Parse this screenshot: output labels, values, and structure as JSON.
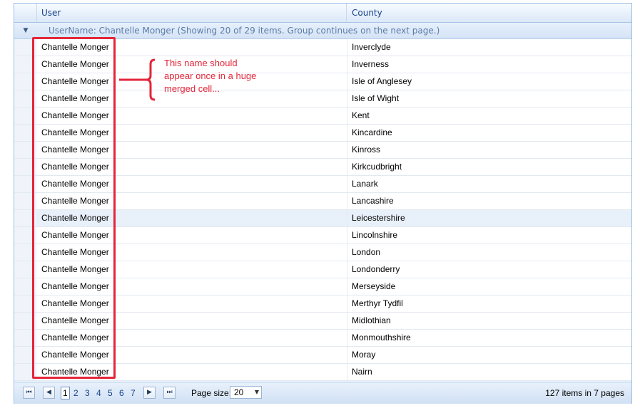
{
  "header": {
    "user": "User",
    "county": "County"
  },
  "group": {
    "expander_icon": "collapse-triangle-icon",
    "text": "UserName: Chantelle Monger (Showing 20 of 29 items. Group continues on the next page.)"
  },
  "rows": [
    {
      "user": "Chantelle Monger",
      "county": "Inverclyde"
    },
    {
      "user": "Chantelle Monger",
      "county": "Inverness"
    },
    {
      "user": "Chantelle Monger",
      "county": "Isle of Anglesey"
    },
    {
      "user": "Chantelle Monger",
      "county": "Isle of Wight"
    },
    {
      "user": "Chantelle Monger",
      "county": "Kent"
    },
    {
      "user": "Chantelle Monger",
      "county": "Kincardine"
    },
    {
      "user": "Chantelle Monger",
      "county": "Kinross"
    },
    {
      "user": "Chantelle Monger",
      "county": "Kirkcudbright"
    },
    {
      "user": "Chantelle Monger",
      "county": "Lanark"
    },
    {
      "user": "Chantelle Monger",
      "county": "Lancashire"
    },
    {
      "user": "Chantelle Monger",
      "county": "Leicestershire"
    },
    {
      "user": "Chantelle Monger",
      "county": "Lincolnshire"
    },
    {
      "user": "Chantelle Monger",
      "county": "London"
    },
    {
      "user": "Chantelle Monger",
      "county": "Londonderry"
    },
    {
      "user": "Chantelle Monger",
      "county": "Merseyside"
    },
    {
      "user": "Chantelle Monger",
      "county": "Merthyr Tydfil"
    },
    {
      "user": "Chantelle Monger",
      "county": "Midlothian"
    },
    {
      "user": "Chantelle Monger",
      "county": "Monmouthshire"
    },
    {
      "user": "Chantelle Monger",
      "county": "Moray"
    },
    {
      "user": "Chantelle Monger",
      "county": "Nairn"
    }
  ],
  "annotation": {
    "line1": "This name should",
    "line2": "appear once in a huge",
    "line3": "merged cell...",
    "color": "#e3263a"
  },
  "pager": {
    "first_icon": "first-page-icon",
    "prev_icon": "previous-page-icon",
    "next_icon": "next-page-icon",
    "last_icon": "last-page-icon",
    "pages": [
      "1",
      "2",
      "3",
      "4",
      "5",
      "6",
      "7"
    ],
    "current_page": "1",
    "page_size_label": "Page size:",
    "page_size_value": "20",
    "info": "127 items in 7 pages"
  }
}
